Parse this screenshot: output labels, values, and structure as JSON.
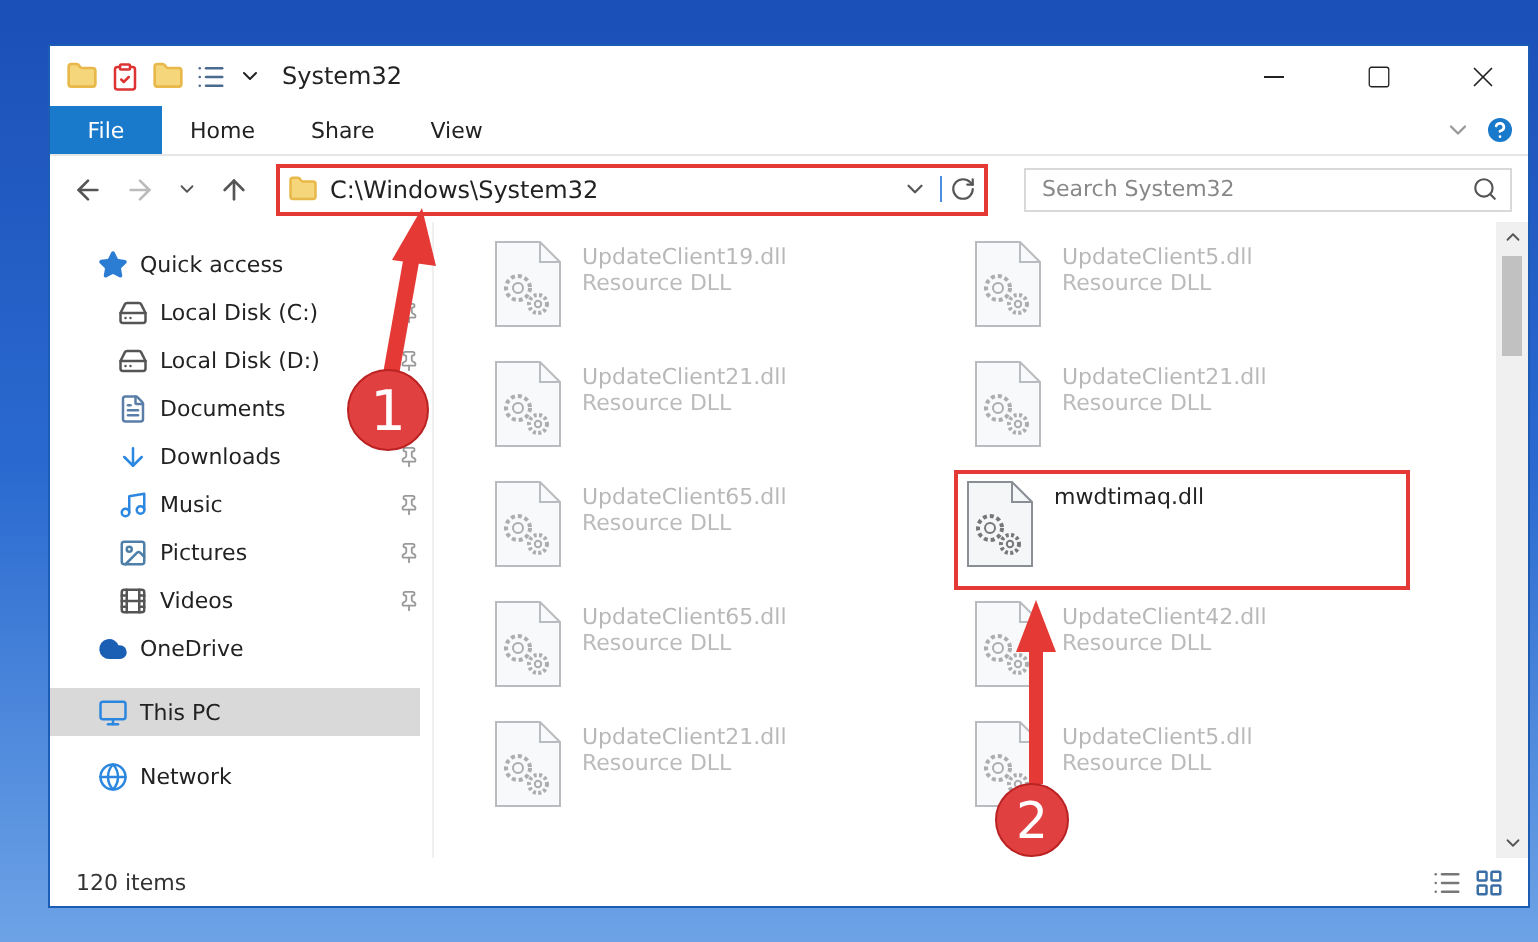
{
  "window": {
    "title": "System32"
  },
  "ribbon": {
    "file_button": "File",
    "tabs": [
      {
        "label": "Home",
        "selected": false
      },
      {
        "label": "Share",
        "selected": false
      },
      {
        "label": "View",
        "selected": false
      }
    ]
  },
  "address": {
    "path": "C:\\Windows\\System32",
    "highlighted": true
  },
  "search": {
    "placeholder": "Search System32"
  },
  "sidebar": {
    "items": [
      {
        "label": "Quick access",
        "kind": "star",
        "selected": false,
        "children": [
          {
            "label": "Local Disk (C:)",
            "kind": "system-drive",
            "pinned": true
          },
          {
            "label": "Local Disk (D:)",
            "kind": "drive",
            "pinned": true
          },
          {
            "label": "Documents",
            "kind": "document"
          },
          {
            "label": "Downloads",
            "kind": "download",
            "pinned": true
          },
          {
            "label": "Music",
            "kind": "music",
            "pinned": true
          },
          {
            "label": "Pictures",
            "kind": "picture-folder",
            "pinned": true
          },
          {
            "label": "Videos",
            "kind": "video",
            "pinned": true
          }
        ]
      },
      {
        "label": "OneDrive",
        "kind": "cloud",
        "selected": false
      },
      {
        "label": "This PC",
        "kind": "computer",
        "selected": true
      },
      {
        "label": "Network",
        "kind": "network",
        "selected": false
      }
    ]
  },
  "files": [
    {
      "name": "UpdateClient19.dll",
      "type": "Resource DLL",
      "blurred": true,
      "highlighted": false
    },
    {
      "name": "UpdateClient5.dll",
      "type": "Resource DLL",
      "blurred": true,
      "highlighted": false
    },
    {
      "name": "UpdateClient21.dll",
      "type": "Resource DLL",
      "blurred": true,
      "highlighted": false
    },
    {
      "name": "UpdateClient21.dll",
      "type": "Resource DLL",
      "blurred": true,
      "highlighted": false
    },
    {
      "name": "UpdateClient65.dll",
      "type": "Resource DLL",
      "blurred": true,
      "highlighted": false
    },
    {
      "name": "mwdtimaq.dll",
      "blurred": false,
      "highlighted": true
    },
    {
      "name": "UpdateClient65.dll",
      "type": "Resource DLL",
      "blurred": true,
      "highlighted": false
    },
    {
      "name": "UpdateClient42.dll",
      "type": "Resource DLL",
      "blurred": true,
      "highlighted": false
    },
    {
      "name": "UpdateClient21.dll",
      "type": "Resource DLL",
      "blurred": true,
      "highlighted": false
    },
    {
      "name": "UpdateClient5.dll",
      "type": "Resource DLL",
      "blurred": true,
      "highlighted": false
    }
  ],
  "status_bar": {
    "item_count": "120 items"
  },
  "annotations": [
    {
      "number": "1"
    },
    {
      "number": "2"
    }
  ]
}
